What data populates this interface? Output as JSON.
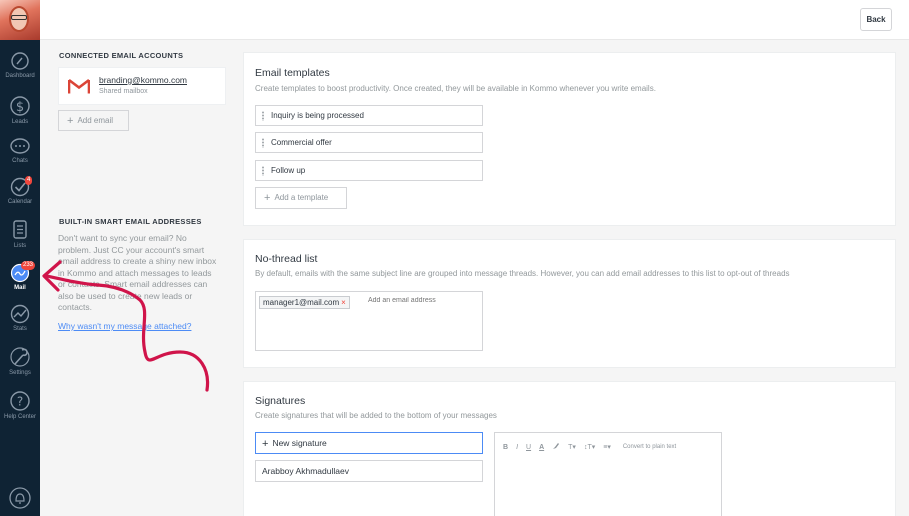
{
  "topbar": {
    "back_label": "Back"
  },
  "sidebar": {
    "items": [
      {
        "label": "Dashboard",
        "icon": "dashboard-icon"
      },
      {
        "label": "Leads",
        "icon": "dollar-icon"
      },
      {
        "label": "Chats",
        "icon": "chat-icon"
      },
      {
        "label": "Calendar",
        "icon": "check-icon",
        "badge": "4"
      },
      {
        "label": "Lists",
        "icon": "list-icon"
      },
      {
        "label": "Mail",
        "icon": "mail-icon",
        "badge": "233",
        "active": true
      },
      {
        "label": "Stats",
        "icon": "stats-icon"
      },
      {
        "label": "Settings",
        "icon": "wrench-icon"
      },
      {
        "label": "Help Center",
        "icon": "question-icon"
      }
    ]
  },
  "connected": {
    "title": "CONNECTED EMAIL ACCOUNTS",
    "account_email": "branding@kommo.com",
    "account_type": "Shared mailbox",
    "add_email_label": "Add email"
  },
  "smart": {
    "title": "BUILT-IN SMART EMAIL ADDRESSES",
    "text": "Don't want to sync your email? No problem. Just CC your account's smart email address to create a shiny new inbox in Kommo and attach messages to leads or contacts. Smart email addresses can also be used to create new leads or contacts.",
    "link": "Why wasn't my message attached?"
  },
  "templates": {
    "title": "Email templates",
    "subtitle": "Create templates to boost productivity. Once created, they will be available in Kommo whenever you write emails.",
    "items": [
      "Inquiry is being processed",
      "Commercial offer",
      "Follow up"
    ],
    "add_label": "Add a template"
  },
  "nothread": {
    "title": "No-thread list",
    "subtitle": "By default, emails with the same subject line are grouped into message threads. However, you can add email addresses to this list to opt-out of threads",
    "tag": "manager1@mail.com",
    "placeholder": "Add an email address"
  },
  "signatures": {
    "title": "Signatures",
    "subtitle": "Create signatures that will be added to the bottom of your messages",
    "new_label": "New signature",
    "items": [
      "Arabboy Akhmadullaev"
    ],
    "toolbar": {
      "bold": "B",
      "italic": "I",
      "underline": "U",
      "color": "A",
      "highlight": "",
      "font_size": "T",
      "line_height": "↕T",
      "align": "≡",
      "convert": "Convert to plain text"
    }
  },
  "colors": {
    "sidebar": "#0f2334",
    "accent": "#4c8bf5",
    "badge": "#f0473d",
    "annotation": "#d0144a"
  }
}
